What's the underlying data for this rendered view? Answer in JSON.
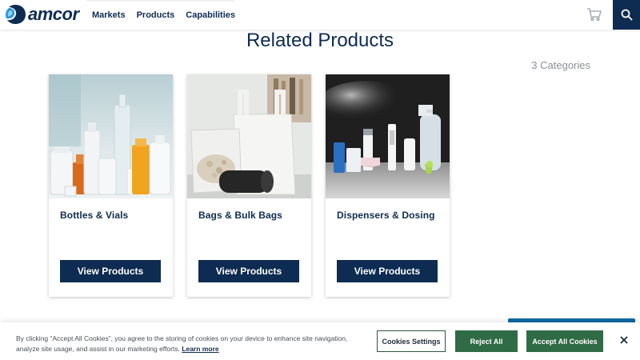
{
  "header": {
    "logo_text": "amcor",
    "nav": [
      "Markets",
      "Products",
      "Capabilities"
    ]
  },
  "section": {
    "title": "Related Products",
    "categories_count": "3 Categories"
  },
  "cards": [
    {
      "title": "Bottles & Vials",
      "button": "View Products"
    },
    {
      "title": "Bags & Bulk Bags",
      "button": "View Products"
    },
    {
      "title": "Dispensers & Dosing",
      "button": "View Products"
    }
  ],
  "cookie": {
    "text": "By clicking “Accept All Cookies”, you agree to the storing of cookies on your device to enhance site navigation, analyze site usage, and assist in our marketing efforts.",
    "link": "Learn more",
    "settings": "Cookies Settings",
    "reject": "Reject All",
    "accept": "Accept All Cookies"
  },
  "colors": {
    "brand_navy": "#0e2c52",
    "cookie_green": "#2f6b45"
  }
}
